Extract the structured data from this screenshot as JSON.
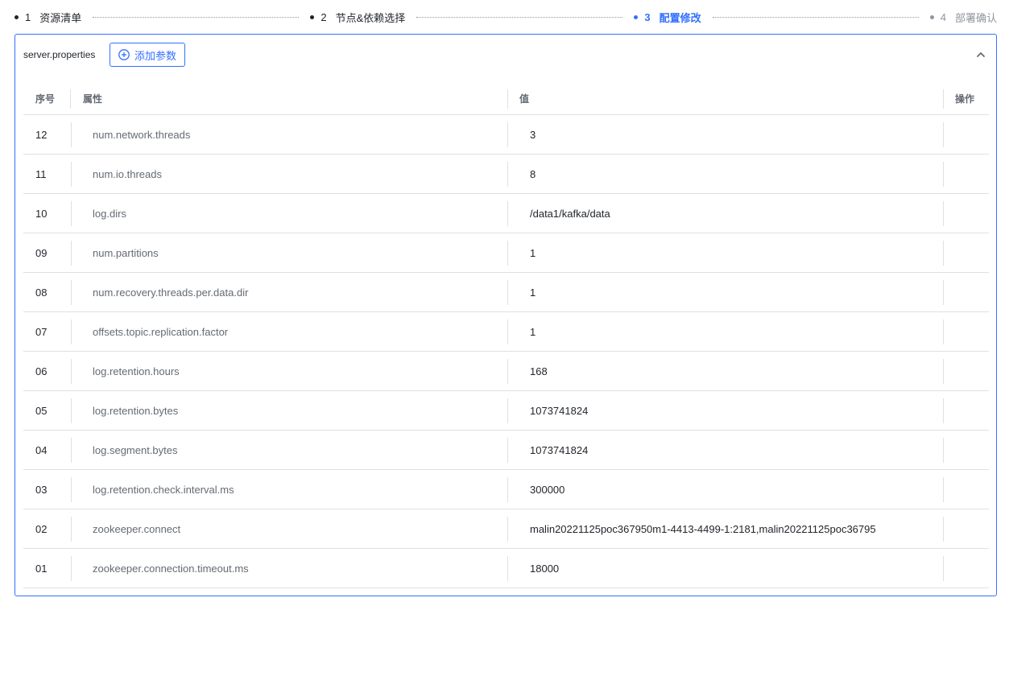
{
  "stepper": {
    "steps": [
      {
        "num": "1",
        "label": "资源清单",
        "state": "done"
      },
      {
        "num": "2",
        "label": "节点&依赖选择",
        "state": "done"
      },
      {
        "num": "3",
        "label": "配置修改",
        "state": "active"
      },
      {
        "num": "4",
        "label": "部署确认",
        "state": "pending"
      }
    ]
  },
  "panel": {
    "file_name": "server.properties",
    "add_button_label": "添加参数",
    "collapse_icon": "chevron-up-icon",
    "accent_color": "#3370ff"
  },
  "table": {
    "headers": {
      "index": "序号",
      "property": "属性",
      "value": "值",
      "action": "操作"
    },
    "rows": [
      {
        "index": "12",
        "property": "num.network.threads",
        "value": "3"
      },
      {
        "index": "11",
        "property": "num.io.threads",
        "value": "8"
      },
      {
        "index": "10",
        "property": "log.dirs",
        "value": "/data1/kafka/data"
      },
      {
        "index": "09",
        "property": "num.partitions",
        "value": "1"
      },
      {
        "index": "08",
        "property": "num.recovery.threads.per.data.dir",
        "value": "1"
      },
      {
        "index": "07",
        "property": "offsets.topic.replication.factor",
        "value": "1"
      },
      {
        "index": "06",
        "property": "log.retention.hours",
        "value": "168"
      },
      {
        "index": "05",
        "property": "log.retention.bytes",
        "value": "1073741824"
      },
      {
        "index": "04",
        "property": "log.segment.bytes",
        "value": "1073741824"
      },
      {
        "index": "03",
        "property": "log.retention.check.interval.ms",
        "value": "300000"
      },
      {
        "index": "02",
        "property": "zookeeper.connect",
        "value": "malin20221125poc367950m1-4413-4499-1:2181,malin20221125poc36795"
      },
      {
        "index": "01",
        "property": "zookeeper.connection.timeout.ms",
        "value": "18000"
      }
    ]
  }
}
